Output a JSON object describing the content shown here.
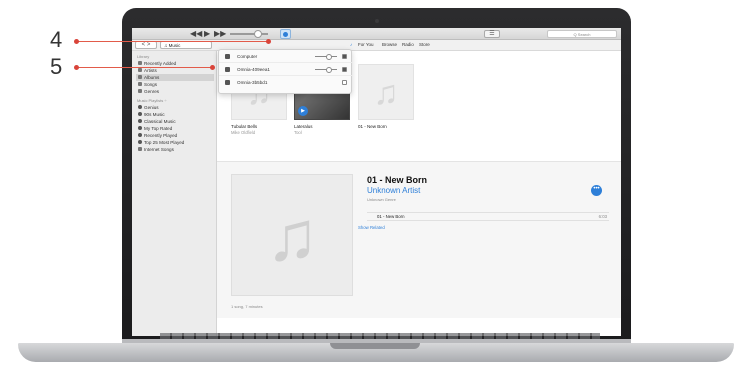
{
  "callouts": [
    {
      "number": "4"
    },
    {
      "number": "5"
    }
  ],
  "colors": {
    "accent": "#2e7fd8",
    "callout": "#d9443a"
  },
  "titlebar": {
    "rewind_icon": "rewind-icon",
    "play_icon": "play-icon",
    "forward_icon": "fast-forward-icon",
    "apple_icon": "apple-logo-icon",
    "search_placeholder": "Q Search"
  },
  "navbar": {
    "back_forward": "< >",
    "source_label": "♫ Music",
    "tabs": [
      "For You",
      "Browse",
      "Radio",
      "Store"
    ]
  },
  "sidebar": {
    "library_heading": "Library",
    "library_items": [
      {
        "label": "Recently Added",
        "selected": false
      },
      {
        "label": "Artists",
        "selected": false
      },
      {
        "label": "Albums",
        "selected": true
      },
      {
        "label": "Songs",
        "selected": false
      },
      {
        "label": "Genres",
        "selected": false
      }
    ],
    "playlists_heading": "Music Playlists ÷",
    "playlist_items": [
      "Genius",
      "90s Music",
      "Classical Music",
      "My Top Rated",
      "Recently Played",
      "Top 25 Most Played",
      "Internet Songs"
    ]
  },
  "albums": [
    {
      "title": "Tubular Bells",
      "artist": "Mike Oldfield"
    },
    {
      "title": "Lateralus",
      "artist": "Tool"
    },
    {
      "title": "01 - New Born",
      "artist": ""
    }
  ],
  "airplay_menu": {
    "devices": [
      {
        "label": "Computer",
        "checked": true
      },
      {
        "label": "Omnia-409eea1",
        "checked": true
      },
      {
        "label": "Omnia-3b5bd1",
        "checked": false
      }
    ]
  },
  "detail": {
    "title": "01 - New Born",
    "artist": "Unknown Artist",
    "genre": "Unknown Genre",
    "more_label": "•••",
    "track_name": "01 - New Born",
    "track_time": "6:03",
    "show_related": "Show Related",
    "song_count": "1 song, 7 minutes"
  }
}
